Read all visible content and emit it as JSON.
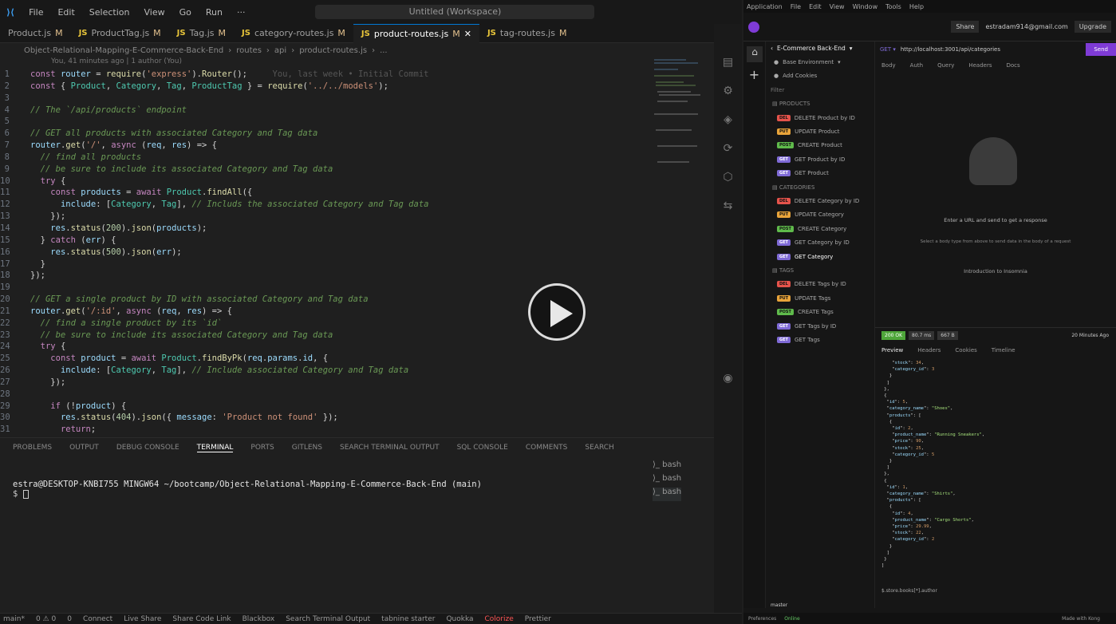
{
  "vscode": {
    "menu": [
      "File",
      "Edit",
      "Selection",
      "View",
      "Go",
      "Run",
      "···"
    ],
    "search": "Untitled (Workspace)",
    "tabs": [
      {
        "label": "Product.js",
        "mod": "M"
      },
      {
        "label": "ProductTag.js",
        "mod": "M"
      },
      {
        "label": "Tag.js",
        "mod": "M"
      },
      {
        "label": "category-routes.js",
        "mod": "M"
      },
      {
        "label": "product-routes.js",
        "mod": "M"
      },
      {
        "label": "tag-routes.js",
        "mod": "M"
      }
    ],
    "js_badge": "JS",
    "breadcrumb": [
      "Object-Relational-Mapping-E-Commerce-Back-End",
      "routes",
      "api",
      "product-routes.js",
      "..."
    ],
    "blame": "You, 41 minutes ago | 1 author (You)",
    "inline_blame": "You, last week • Initial Commit",
    "panel_tabs": [
      "PROBLEMS",
      "OUTPUT",
      "DEBUG CONSOLE",
      "TERMINAL",
      "PORTS",
      "GITLENS",
      "SEARCH TERMINAL OUTPUT",
      "SQL CONSOLE",
      "COMMENTS",
      "SEARCH"
    ],
    "terminal_prompt": "estra@DESKTOP-KNBI755 MINGW64 ~/bootcamp/Object-Relational-Mapping-E-Commerce-Back-End (main)",
    "terminal_cursor": "$ ",
    "bash_list": [
      "bash",
      "bash",
      "bash"
    ],
    "status": [
      "main*",
      "0 ⚠ 0",
      "0",
      "Connect",
      "Live Share",
      "Share Code Link",
      "Blackbox",
      "Search Terminal Output",
      "tabnine starter",
      "Quokka",
      "Colorize",
      "Prettier"
    ]
  },
  "insomnia": {
    "menu": [
      "Application",
      "File",
      "Edit",
      "View",
      "Window",
      "Tools",
      "Help"
    ],
    "title": "Insomnia",
    "share": "Share",
    "email": "estradam914@gmail.com",
    "upgrade": "Upgrade",
    "project": "E-Commerce Back-End",
    "env": "Base Environment",
    "cookies": "Add Cookies",
    "filter": "Filter",
    "folders": [
      {
        "name": "PRODUCTS",
        "items": [
          [
            "DEL",
            "DELETE Product by ID"
          ],
          [
            "PUT",
            "UPDATE Product"
          ],
          [
            "POST",
            "CREATE Product"
          ],
          [
            "GET",
            "GET Product by ID"
          ],
          [
            "GET",
            "GET Product"
          ]
        ]
      },
      {
        "name": "CATEGORIES",
        "items": [
          [
            "DEL",
            "DELETE Category by ID"
          ],
          [
            "PUT",
            "UPDATE Category"
          ],
          [
            "POST",
            "CREATE Category"
          ],
          [
            "GET",
            "GET Category by ID"
          ],
          [
            "GET",
            "GET Category"
          ]
        ]
      },
      {
        "name": "TAGS",
        "items": [
          [
            "DEL",
            "DELETE Tags by ID"
          ],
          [
            "PUT",
            "UPDATE Tags"
          ],
          [
            "POST",
            "CREATE Tags"
          ],
          [
            "GET",
            "GET Tags by ID"
          ],
          [
            "GET",
            "GET Tags"
          ]
        ]
      }
    ],
    "url": "http://localhost:3001/api/categories",
    "send": "Send",
    "req_tabs": [
      "Body",
      "Auth",
      "Query",
      "Headers",
      "Docs"
    ],
    "empty1": "Enter a URL and send to get a response",
    "empty2": "Select a body type from above to send data in the body of a request",
    "intro": "Introduction to Insomnia",
    "status": "200 OK",
    "time": "80.7 ms",
    "size": "667 B",
    "ago": "20 Minutes Ago",
    "resp_tabs": [
      "Preview",
      "Headers",
      "Cookies",
      "Timeline"
    ],
    "jq": "$.store.books[*].author",
    "branch": "master",
    "bottom": [
      "Preferences",
      "Online",
      "Made with Kong"
    ]
  }
}
